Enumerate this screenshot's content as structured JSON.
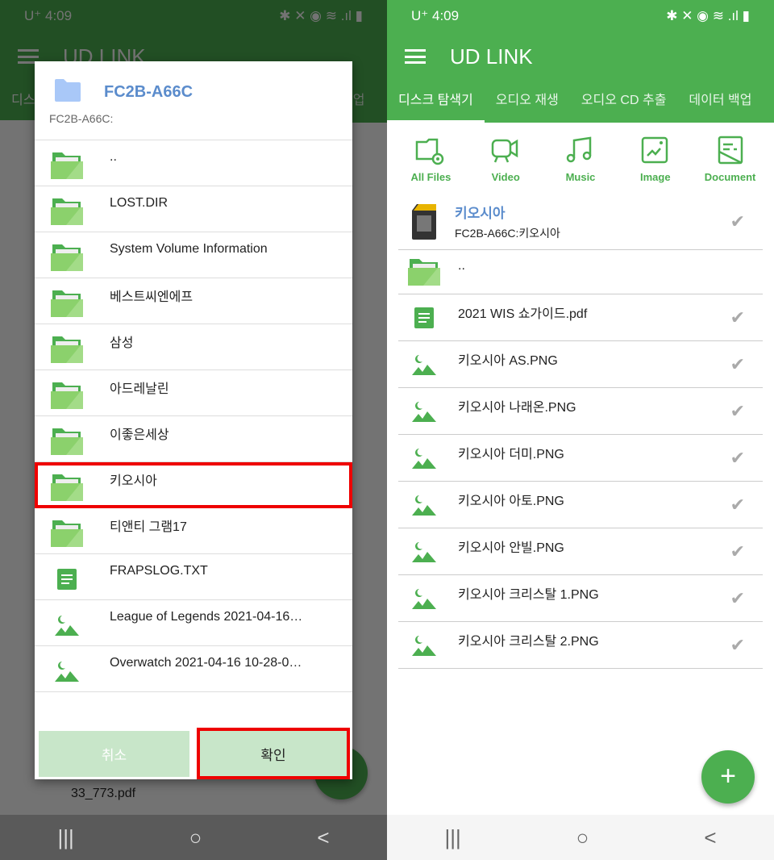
{
  "status": {
    "carrier": "U⁺",
    "time": "4:09",
    "right_icons": "✱ ✕ ◉ ≋ .ıl ▮"
  },
  "app": {
    "title": "UD LINK",
    "accent": "#4caf50",
    "tabs": [
      "디스크 탐색기",
      "오디오 재생",
      "오디오 CD 추출",
      "데이터 백업"
    ]
  },
  "categories": [
    {
      "label": "All Files",
      "icon": "folder-disc-icon"
    },
    {
      "label": "Video",
      "icon": "video-camera-icon"
    },
    {
      "label": "Music",
      "icon": "music-note-icon"
    },
    {
      "label": "Image",
      "icon": "image-icon"
    },
    {
      "label": "Document",
      "icon": "document-icon"
    }
  ],
  "dialog": {
    "title": "FC2B-A66C",
    "path": "FC2B-A66C:",
    "items": [
      {
        "name": "..",
        "type": "folder"
      },
      {
        "name": "LOST.DIR",
        "type": "folder"
      },
      {
        "name": "System Volume Information",
        "type": "folder"
      },
      {
        "name": "베스트씨엔에프",
        "type": "folder"
      },
      {
        "name": "삼성",
        "type": "folder"
      },
      {
        "name": "아드레날린",
        "type": "folder"
      },
      {
        "name": "이좋은세상",
        "type": "folder"
      },
      {
        "name": "키오시아",
        "type": "folder",
        "highlighted": true
      },
      {
        "name": "티앤티 그램17",
        "type": "folder"
      },
      {
        "name": "FRAPSLOG.TXT",
        "type": "document"
      },
      {
        "name": "League of Legends 2021-04-16…",
        "type": "image"
      },
      {
        "name": "Overwatch 2021-04-16 10-28-0…",
        "type": "image"
      }
    ],
    "cancel": "취소",
    "ok": "확인"
  },
  "background_file": "33_773.pdf",
  "current": {
    "name": "키오시아",
    "path": "FC2B-A66C:키오시아"
  },
  "files": [
    {
      "name": "..",
      "type": "folder"
    },
    {
      "name": "2021 WIS 쇼가이드.pdf",
      "type": "document"
    },
    {
      "name": "키오시아 AS.PNG",
      "type": "image"
    },
    {
      "name": "키오시아 나래온.PNG",
      "type": "image"
    },
    {
      "name": "키오시아 더미.PNG",
      "type": "image"
    },
    {
      "name": "키오시아 아토.PNG",
      "type": "image"
    },
    {
      "name": "키오시아 안빌.PNG",
      "type": "image"
    },
    {
      "name": "키오시아 크리스탈 1.PNG",
      "type": "image"
    },
    {
      "name": "키오시아 크리스탈 2.PNG",
      "type": "image"
    }
  ],
  "fab": "+",
  "nav": {
    "recent": "|||",
    "home": "○",
    "back": "<"
  }
}
